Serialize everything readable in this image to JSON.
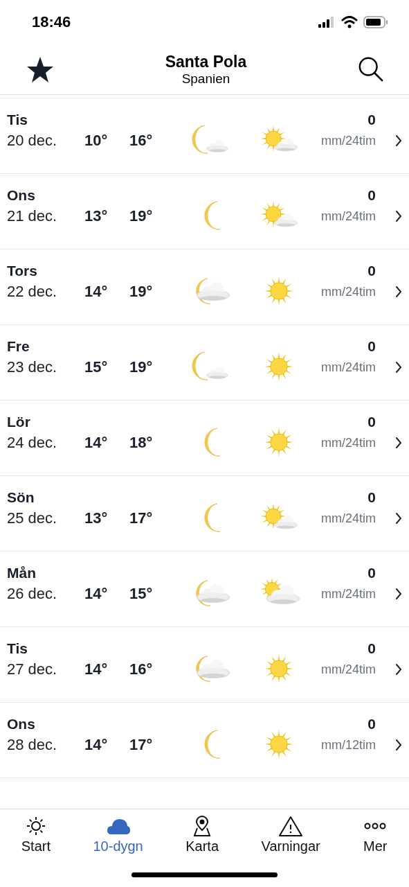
{
  "status_bar": {
    "time": "18:46"
  },
  "header": {
    "title": "Santa Pola",
    "subtitle": "Spanien"
  },
  "days": [
    {
      "day": "Tis",
      "date": "20 dec.",
      "min": "10°",
      "max": "16°",
      "night": {
        "kind": "moon-cloud"
      },
      "daytime": {
        "kind": "sun-cloud"
      },
      "precip": "0",
      "unit": "mm/24tim"
    },
    {
      "day": "Ons",
      "date": "21 dec.",
      "min": "13°",
      "max": "19°",
      "night": {
        "kind": "moon"
      },
      "daytime": {
        "kind": "sun-cloud"
      },
      "precip": "0",
      "unit": "mm/24tim"
    },
    {
      "day": "Tors",
      "date": "22 dec.",
      "min": "14°",
      "max": "19°",
      "night": {
        "kind": "cloud-moon"
      },
      "daytime": {
        "kind": "sun"
      },
      "precip": "0",
      "unit": "mm/24tim"
    },
    {
      "day": "Fre",
      "date": "23 dec.",
      "min": "15°",
      "max": "19°",
      "night": {
        "kind": "moon-cloud"
      },
      "daytime": {
        "kind": "sun"
      },
      "precip": "0",
      "unit": "mm/24tim"
    },
    {
      "day": "Lör",
      "date": "24 dec.",
      "min": "14°",
      "max": "18°",
      "night": {
        "kind": "moon"
      },
      "daytime": {
        "kind": "sun"
      },
      "precip": "0",
      "unit": "mm/24tim"
    },
    {
      "day": "Sön",
      "date": "25 dec.",
      "min": "13°",
      "max": "17°",
      "night": {
        "kind": "moon"
      },
      "daytime": {
        "kind": "sun-cloud"
      },
      "precip": "0",
      "unit": "mm/24tim"
    },
    {
      "day": "Mån",
      "date": "26 dec.",
      "min": "14°",
      "max": "15°",
      "night": {
        "kind": "cloud-moon"
      },
      "daytime": {
        "kind": "cloud-sun"
      },
      "precip": "0",
      "unit": "mm/24tim"
    },
    {
      "day": "Tis",
      "date": "27 dec.",
      "min": "14°",
      "max": "16°",
      "night": {
        "kind": "cloud-moon"
      },
      "daytime": {
        "kind": "sun"
      },
      "precip": "0",
      "unit": "mm/24tim"
    },
    {
      "day": "Ons",
      "date": "28 dec.",
      "min": "14°",
      "max": "17°",
      "night": {
        "kind": "moon"
      },
      "daytime": {
        "kind": "sun"
      },
      "precip": "0",
      "unit": "mm/12tim"
    }
  ],
  "tab_bar": [
    {
      "kind": "start",
      "label": "Start",
      "selected": false
    },
    {
      "kind": "days",
      "label": "10-dygn",
      "selected": true
    },
    {
      "kind": "map",
      "label": "Karta",
      "selected": false
    },
    {
      "kind": "warnings",
      "label": "Varningar",
      "selected": false
    },
    {
      "kind": "more",
      "label": "Mer",
      "selected": false
    }
  ]
}
